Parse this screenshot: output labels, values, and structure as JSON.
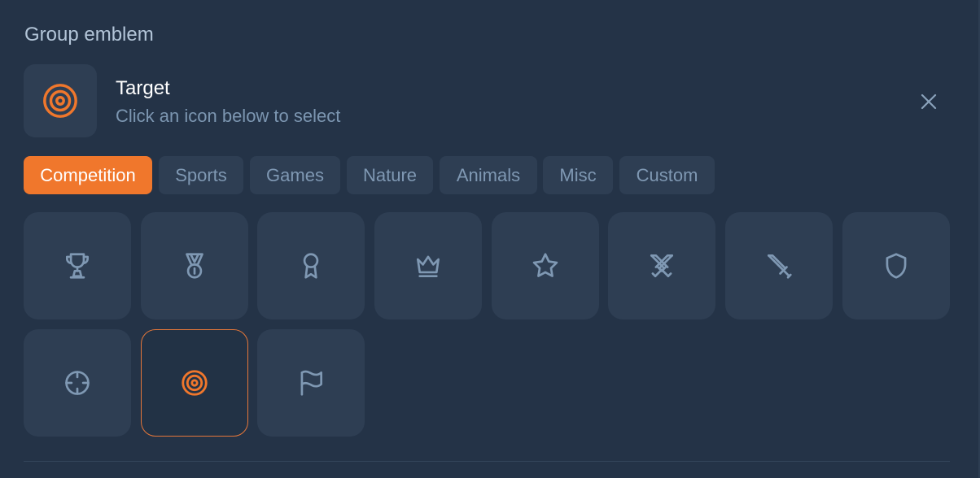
{
  "header": {
    "title": "Group emblem"
  },
  "selection": {
    "name": "Target",
    "hint": "Click an icon below to select",
    "icon": "target-icon"
  },
  "tabs": [
    {
      "label": "Competition",
      "active": true
    },
    {
      "label": "Sports",
      "active": false
    },
    {
      "label": "Games",
      "active": false
    },
    {
      "label": "Nature",
      "active": false
    },
    {
      "label": "Animals",
      "active": false
    },
    {
      "label": "Misc",
      "active": false
    },
    {
      "label": "Custom",
      "active": false
    }
  ],
  "icons": [
    {
      "name": "trophy-icon",
      "selected": false
    },
    {
      "name": "medal-icon",
      "selected": false
    },
    {
      "name": "award-ribbon-icon",
      "selected": false
    },
    {
      "name": "crown-icon",
      "selected": false
    },
    {
      "name": "star-icon",
      "selected": false
    },
    {
      "name": "crossed-swords-icon",
      "selected": false
    },
    {
      "name": "sword-icon",
      "selected": false
    },
    {
      "name": "shield-icon",
      "selected": false
    },
    {
      "name": "crosshair-icon",
      "selected": false
    },
    {
      "name": "target-icon",
      "selected": true
    },
    {
      "name": "flag-icon",
      "selected": false
    }
  ],
  "colors": {
    "background": "#243347",
    "tile": "#2e3e53",
    "accent": "#f0772c",
    "icon": "#7f98b3",
    "text_muted": "#7c96b1"
  }
}
